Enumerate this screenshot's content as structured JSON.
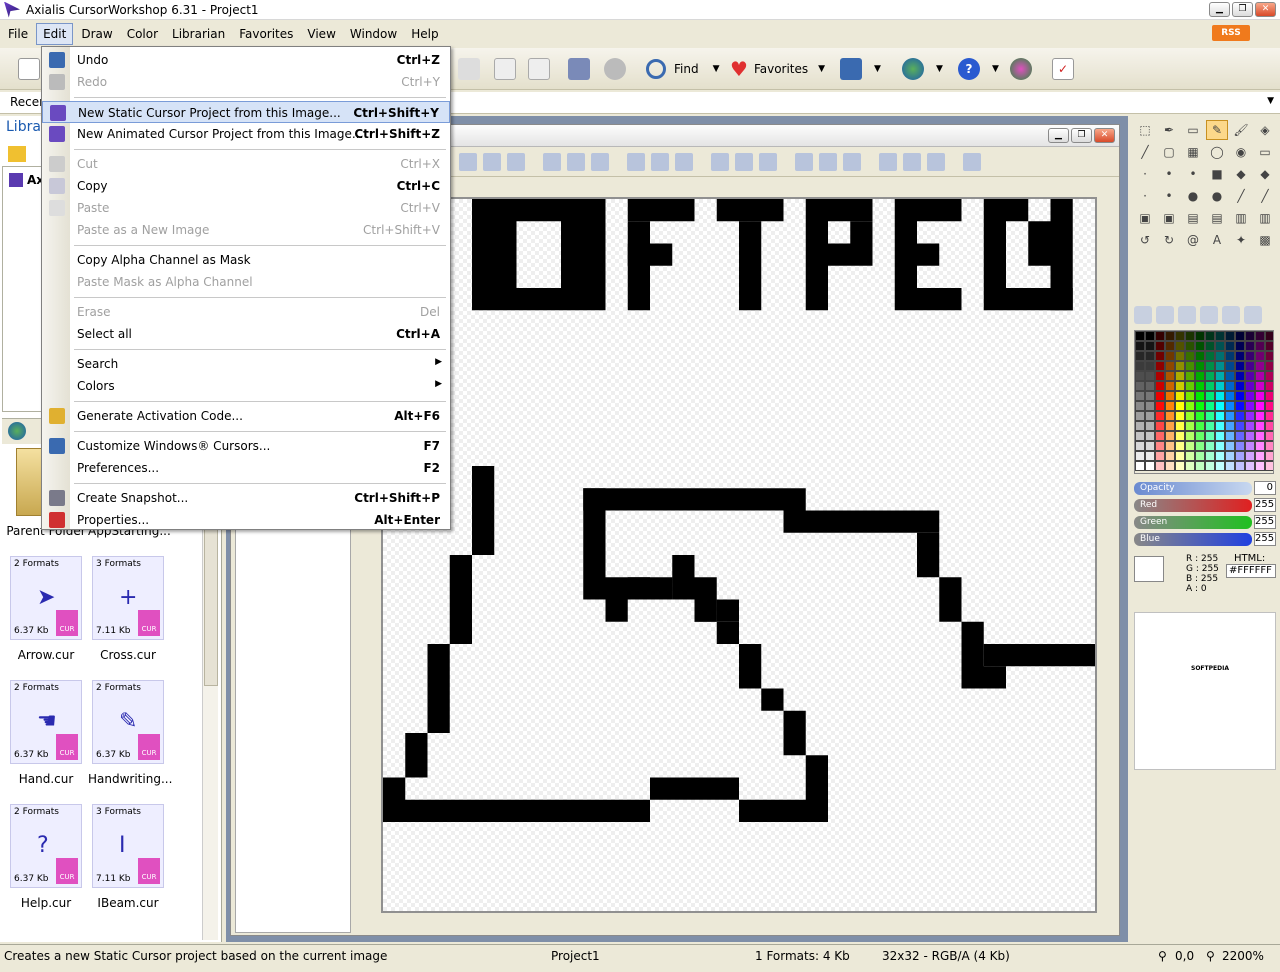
{
  "window": {
    "title": "Axialis CursorWorkshop 6.31 - Project1"
  },
  "menubar": [
    "File",
    "Edit",
    "Draw",
    "Color",
    "Librarian",
    "Favorites",
    "View",
    "Window",
    "Help"
  ],
  "rss": "RSS",
  "toolbar": {
    "find": "Find",
    "favorites": "Favorites"
  },
  "left": {
    "recent": "Recen",
    "library": "Libra",
    "tree_root": "Axi"
  },
  "files": [
    {
      "name": "Parent Folder",
      "formats": "",
      "size": "",
      "kind": "folder"
    },
    {
      "name": "AppStarting...",
      "formats": "",
      "size": "",
      "kind": "cur"
    },
    {
      "name": "Arrow.cur",
      "formats": "2 Formats",
      "size": "6.37 Kb",
      "kind": "cur",
      "glyph": "➤"
    },
    {
      "name": "Cross.cur",
      "formats": "3 Formats",
      "size": "7.11 Kb",
      "kind": "cur",
      "glyph": "+"
    },
    {
      "name": "Hand.cur",
      "formats": "2 Formats",
      "size": "6.37 Kb",
      "kind": "cur",
      "glyph": "☚"
    },
    {
      "name": "Handwriting...",
      "formats": "2 Formats",
      "size": "6.37 Kb",
      "kind": "cur",
      "glyph": "✎"
    },
    {
      "name": "Help.cur",
      "formats": "2 Formats",
      "size": "6.37 Kb",
      "kind": "cur",
      "glyph": "?"
    },
    {
      "name": "IBeam.cur",
      "formats": "3 Formats",
      "size": "7.11 Kb",
      "kind": "cur",
      "glyph": "I"
    }
  ],
  "badge": "CUR",
  "menu": [
    {
      "label": "Undo",
      "shortcut": "Ctrl+Z",
      "state": "enabled"
    },
    {
      "label": "Redo",
      "shortcut": "Ctrl+Y",
      "state": "disabled"
    },
    {
      "label": "New Static Cursor Project from this Image...",
      "shortcut": "Ctrl+Shift+Y",
      "state": "highlighted"
    },
    {
      "label": "New Animated Cursor Project from this Image...",
      "shortcut": "Ctrl+Shift+Z",
      "state": "enabled"
    },
    {
      "label": "Cut",
      "shortcut": "Ctrl+X",
      "state": "disabled"
    },
    {
      "label": "Copy",
      "shortcut": "Ctrl+C",
      "state": "enabled"
    },
    {
      "label": "Paste",
      "shortcut": "Ctrl+V",
      "state": "disabled"
    },
    {
      "label": "Paste as a New Image",
      "shortcut": "Ctrl+Shift+V",
      "state": "disabled"
    },
    {
      "label": "Copy Alpha Channel as Mask",
      "shortcut": "",
      "state": "enabled"
    },
    {
      "label": "Paste Mask as Alpha Channel",
      "shortcut": "",
      "state": "disabled"
    },
    {
      "label": "Erase",
      "shortcut": "Del",
      "state": "disabled"
    },
    {
      "label": "Select all",
      "shortcut": "Ctrl+A",
      "state": "enabled"
    },
    {
      "label": "Search",
      "shortcut": "",
      "state": "submenu"
    },
    {
      "label": "Colors",
      "shortcut": "",
      "state": "submenu"
    },
    {
      "label": "Generate Activation Code...",
      "shortcut": "Alt+F6",
      "state": "enabled"
    },
    {
      "label": "Customize Windows® Cursors...",
      "shortcut": "F7",
      "state": "enabled"
    },
    {
      "label": "Preferences...",
      "shortcut": "F2",
      "state": "enabled"
    },
    {
      "label": "Create Snapshot...",
      "shortcut": "Ctrl+Shift+P",
      "state": "enabled"
    },
    {
      "label": "Properties...",
      "shortcut": "Alt+Enter",
      "state": "enabled"
    }
  ],
  "color": {
    "opacity_label": "Opacity",
    "opacity": "0",
    "red_label": "Red",
    "red": "255",
    "green_label": "Green",
    "green": "255",
    "blue_label": "Blue",
    "blue": "255",
    "r": "R : 255",
    "g": "G : 255",
    "b": "B : 255",
    "a": "A :  0",
    "html_label": "HTML:",
    "html": "#FFFFFF"
  },
  "preview_text": "SOFTPEDIA",
  "status": {
    "message": "Creates a new Static Cursor project based on the current image",
    "project": "Project1",
    "formats": "1 Formats: 4 Kb",
    "size": "32x32 - RGB/A (4 Kb)",
    "coords": "0,0",
    "zoom": "2200%"
  },
  "colors": {
    "accent": "#1a5ab0",
    "menu_highlight": "#d6e3f7",
    "badge": "#e050c0"
  }
}
